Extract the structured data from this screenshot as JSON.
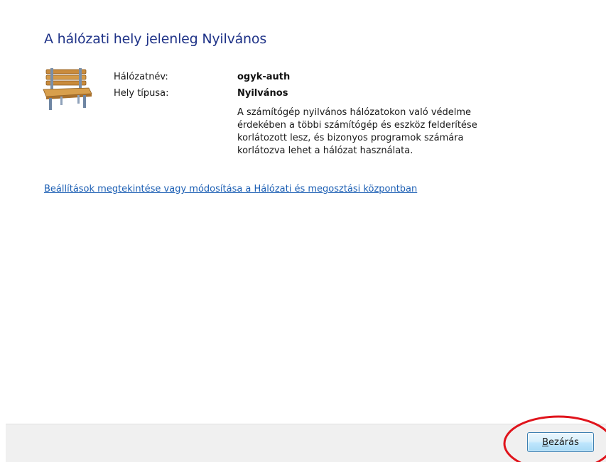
{
  "dialog": {
    "title": "A hálózati hely jelenleg Nyilvános",
    "icon": "public-bench-icon"
  },
  "network": {
    "name_label": "Hálózatnév:",
    "name_value": "ogyk-auth",
    "type_label": "Hely típusa:",
    "type_value": "Nyilvános",
    "description_lines": [
      "A számítógép nyilvános hálózatokon való védelme",
      "érdekében a többi számítógép és eszköz felderítése",
      "korlátozott lesz, és bizonyos programok számára",
      "korlátozva lehet a hálózat használata."
    ]
  },
  "settings_link": "Beállítások megtekintése vagy módosítása a Hálózati és megosztási központban",
  "footer": {
    "close_accel": "B",
    "close_rest": "ezárás"
  },
  "colors": {
    "title": "#1e3287",
    "link": "#1c5fb4",
    "annotation": "#e0141c",
    "footer_bg": "#f0f0f0"
  }
}
